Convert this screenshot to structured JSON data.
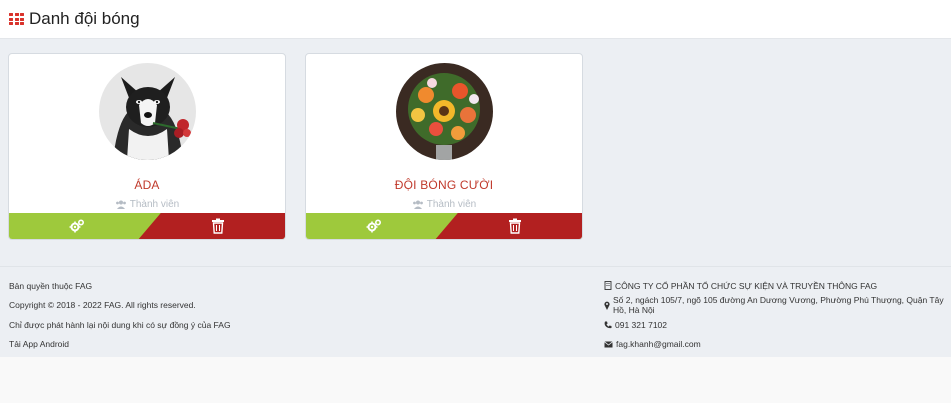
{
  "header": {
    "title": "Danh đội bóng",
    "icon": "grid-icon"
  },
  "cards": [
    {
      "name": "ÁDA",
      "role": "Thành viên",
      "avatar": "husky-dog-with-roses"
    },
    {
      "name": "ĐỘI BÓNG CƯỜI",
      "role": "Thành viên",
      "avatar": "sunflower-bouquet"
    }
  ],
  "footer": {
    "left": [
      "Bản quyền thuộc FAG",
      "Copyright © 2018 - 2022 FAG. All rights reserved.",
      "Chỉ được phát hành lại nội dung khi có sự đồng ý của FAG",
      "Tải App Android"
    ],
    "company": "CÔNG TY CỔ PHẦN TỔ CHỨC SỰ KIỆN VÀ TRUYỀN THÔNG FAG",
    "address": "Số 2, ngách 105/7, ngõ 105 đường An Dương Vương, Phường Phú Thượng, Quận Tây Hồ, Hà Nội",
    "phone": "091 321 7102",
    "email": "fag.khanh@gmail.com"
  },
  "colors": {
    "accent_red": "#c0392b",
    "delete_red": "#b22020",
    "settings_green": "#9ec93c"
  }
}
